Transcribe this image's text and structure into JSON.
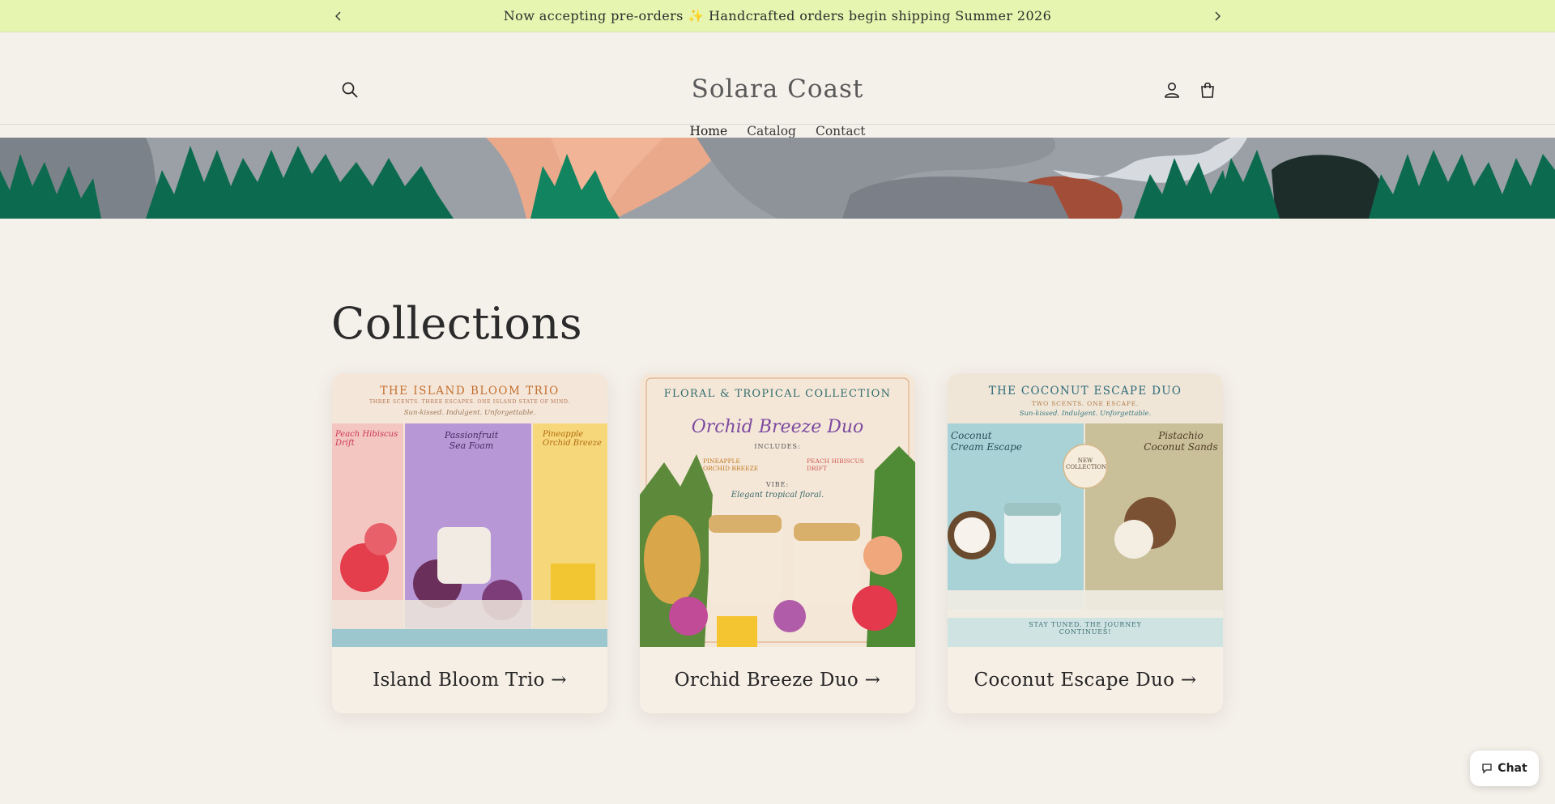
{
  "announcement": {
    "text": "Now accepting pre-orders ✨ Handcrafted orders begin shipping Summer 2026",
    "prev_icon": "chevron-left-icon",
    "next_icon": "chevron-right-icon"
  },
  "header": {
    "store_name": "Solara Coast",
    "icons": [
      "search-icon",
      "account-icon",
      "cart-icon"
    ],
    "nav": [
      {
        "label": "Home",
        "active": true
      },
      {
        "label": "Catalog",
        "active": false
      },
      {
        "label": "Contact",
        "active": false
      }
    ]
  },
  "collections": {
    "heading": "Collections",
    "items": [
      {
        "title": "Island Bloom Trio →",
        "poster": {
          "heading": "THE ISLAND BLOOM TRIO",
          "subheading": "THREE SCENTS. THREE ESCAPES. ONE ISLAND STATE OF MIND.",
          "tagline": "Sun-kissed. Indulgent. Unforgettable.",
          "panels": [
            "Peach Hibiscus Drift",
            "Passionfruit Sea Foam",
            "Pineapple Orchid Breeze"
          ]
        }
      },
      {
        "title": "Orchid Breeze Duo →",
        "poster": {
          "heading": "FLORAL & TROPICAL COLLECTION",
          "name": "Orchid Breeze Duo",
          "includes_label": "INCLUDES:",
          "items": [
            "PINEAPPLE ORCHID BREEZE",
            "PEACH HIBISCUS DRIFT"
          ],
          "vibe_label": "VIBE:",
          "vibe": "Elegant tropical floral."
        }
      },
      {
        "title": "Coconut Escape Duo →",
        "poster": {
          "heading": "THE COCONUT ESCAPE DUO",
          "subheading": "TWO SCENTS. ONE ESCAPE.",
          "tagline": "Sun-kissed. Indulgent. Unforgettable.",
          "left": "Coconut Cream Escape",
          "right": "Pistachio Coconut Sands",
          "badge": "NEW COLLECTION",
          "footer": "STAY TUNED. THE JOURNEY CONTINUES!"
        }
      }
    ]
  },
  "chat": {
    "label": "Chat",
    "icon": "chat-bubble-icon"
  },
  "colors": {
    "announcement_bg": "#e6f5b0",
    "page_bg": "#f4f0ea",
    "banner_green": "#0c6b4e",
    "banner_peach": "#eaa98b",
    "banner_gray": "#8e9399"
  }
}
